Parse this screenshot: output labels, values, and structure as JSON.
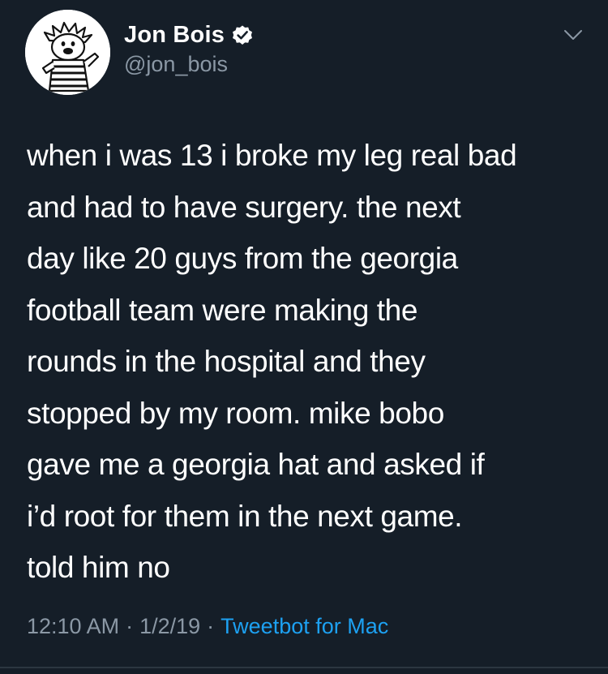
{
  "user": {
    "display_name": "Jon Bois",
    "handle": "@jon_bois",
    "verified": true
  },
  "tweet": {
    "text": "when i was 13 i broke my leg real bad\nand had to have surgery. the next\nday like 20 guys from the georgia\nfootball team were making the\nrounds in the hospital and they\nstopped by my room. mike bobo\ngave me a georgia hat and asked if\ni’d root for them in the next game.\ntold him no",
    "time": "12:10 AM",
    "date": "1/2/19",
    "separator": "·",
    "source": "Tweetbot for Mac"
  },
  "icons": {
    "avatar": "cartoon-avatar",
    "verified": "verified-badge-icon",
    "menu": "chevron-down-icon"
  },
  "colors": {
    "background": "#151e28",
    "text": "#ffffff",
    "muted": "#8b98a5",
    "link": "#1da1f2"
  }
}
